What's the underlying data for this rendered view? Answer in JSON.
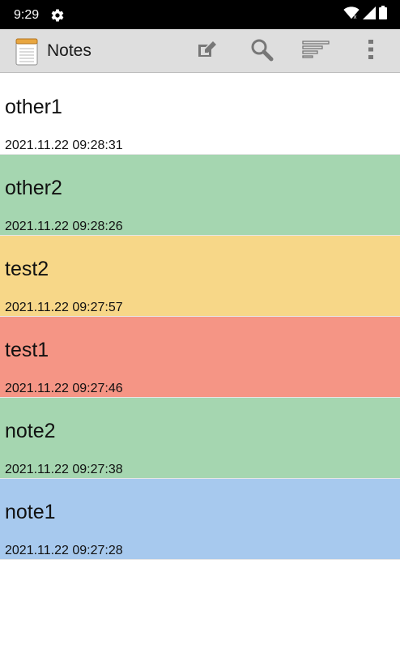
{
  "status_bar": {
    "time": "9:29",
    "settings_icon": "gear-icon",
    "wifi_icon": "wifi-icon",
    "signal_icon": "signal-icon",
    "battery_icon": "battery-icon"
  },
  "app_bar": {
    "title": "Notes",
    "app_icon": "notepad-icon",
    "actions": {
      "compose_icon": "compose-icon",
      "search_icon": "search-icon",
      "sort_icon": "sort-icon",
      "more_icon": "more-vert-icon"
    }
  },
  "notes": [
    {
      "title": "other1",
      "date": "2021.11.22 09:28:31",
      "color": "#ffffff"
    },
    {
      "title": "other2",
      "date": "2021.11.22 09:28:26",
      "color": "#a5d6b0"
    },
    {
      "title": "test2",
      "date": "2021.11.22 09:27:57",
      "color": "#f7d788"
    },
    {
      "title": "test1",
      "date": "2021.11.22 09:27:46",
      "color": "#f59585"
    },
    {
      "title": "note2",
      "date": "2021.11.22 09:27:38",
      "color": "#a5d6b0"
    },
    {
      "title": "note1",
      "date": "2021.11.22 09:27:28",
      "color": "#a7c9ee"
    }
  ],
  "colors": {
    "status_bar_bg": "#000000",
    "app_bar_bg": "#dedede",
    "icon_gray": "#777777"
  }
}
